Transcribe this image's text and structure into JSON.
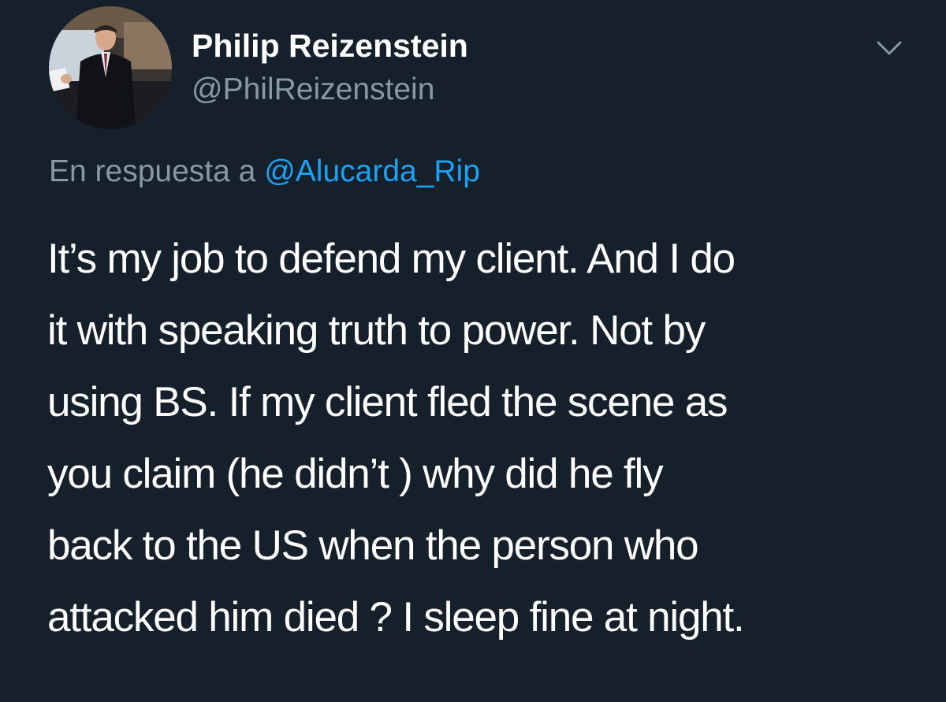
{
  "author": {
    "display_name": "Philip Reizenstein",
    "handle": "@PhilReizenstein"
  },
  "reply": {
    "prefix": "En respuesta a",
    "mention": "@Alucarda_Rip"
  },
  "tweet": {
    "lines": [
      "It’s my job to defend my client. And I do",
      "it with speaking truth to power. Not by",
      "using BS. If my client fled the scene as",
      "you claim (he didn’t ) why did he fly",
      "back to the US when the person who",
      "attacked him died ? I sleep fine at night."
    ]
  },
  "icons": {
    "menu": "chevron-down-icon"
  },
  "colors": {
    "background": "#15202b",
    "primary_text": "#ffffff",
    "secondary_text": "#8899a6",
    "link": "#1da1f2"
  }
}
